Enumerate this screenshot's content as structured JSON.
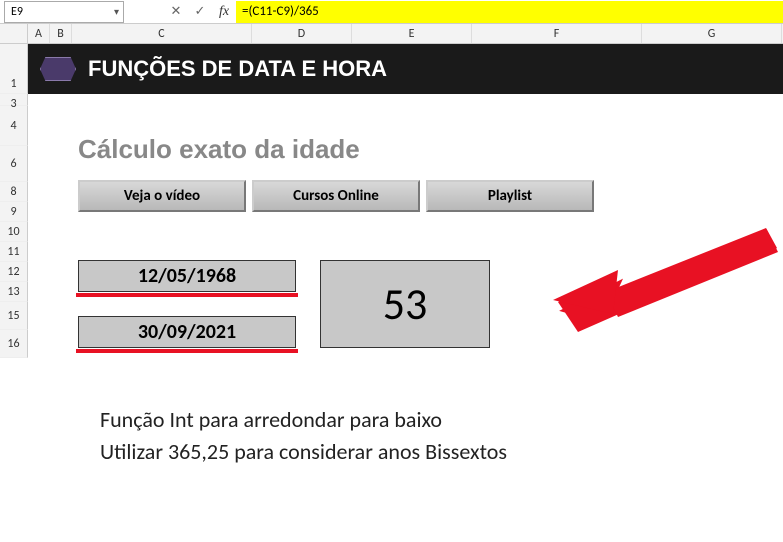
{
  "name_box": "E9",
  "formula": "=(C11-C9)/365",
  "columns": [
    "A",
    "B",
    "C",
    "D",
    "E",
    "F",
    "G"
  ],
  "rows": [
    "1",
    "3",
    "4",
    "6",
    "8",
    "9",
    "10",
    "11",
    "12",
    "13",
    "15",
    "16"
  ],
  "banner": {
    "title": "FUNÇÕES DE DATA E HORA"
  },
  "section_title": "Cálculo exato da idade",
  "buttons": {
    "video": "Veja o vídeo",
    "cursos": "Cursos Online",
    "playlist": "Playlist"
  },
  "dates": {
    "d1": "12/05/1968",
    "d2": "30/09/2021"
  },
  "result": "53",
  "notes": {
    "n1": "Função Int para arredondar para baixo",
    "n2": "Utilizar 365,25 para considerar anos Bissextos"
  }
}
